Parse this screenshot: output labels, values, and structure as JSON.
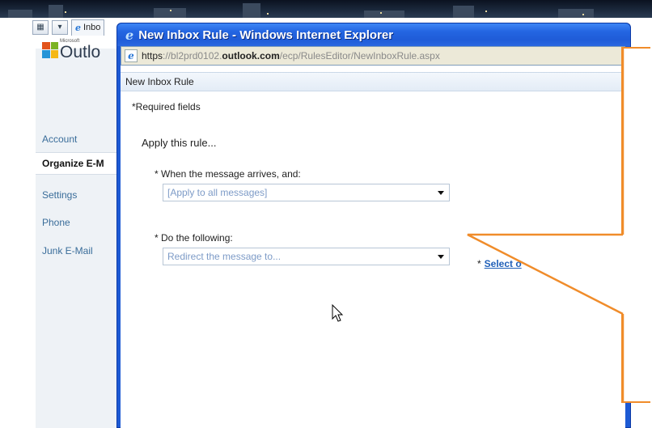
{
  "background_page": {
    "tab_label": "Inbo",
    "logo": {
      "microsoft": "Microsoft",
      "product": "Outlo"
    },
    "nav": [
      {
        "label": "Account"
      },
      {
        "label": "Organize E-M"
      },
      {
        "label": "Settings"
      },
      {
        "label": "Phone"
      },
      {
        "label": "Junk E-Mail"
      }
    ]
  },
  "popup": {
    "title": "New Inbox Rule - Windows Internet Explorer",
    "url": {
      "scheme": "https",
      "pre": "://bl2prd0102.",
      "domain": "outlook.com",
      "path": "/ecp/RulesEditor/NewInboxRule.aspx"
    },
    "header": "New Inbox Rule",
    "required_note": "*Required fields",
    "apply_heading": "Apply this rule...",
    "when_label": "* When the message arrives, and:",
    "when_value": "[Apply to all messages]",
    "do_label": "* Do the following:",
    "do_value": "Redirect the message to...",
    "select_link_star": "*",
    "select_link_text": "Select o"
  },
  "colors": {
    "titlebar": "#2466e2",
    "callout": "#f08c2a",
    "link": "#1f5fb8",
    "select_text": "#7d9bc7"
  }
}
